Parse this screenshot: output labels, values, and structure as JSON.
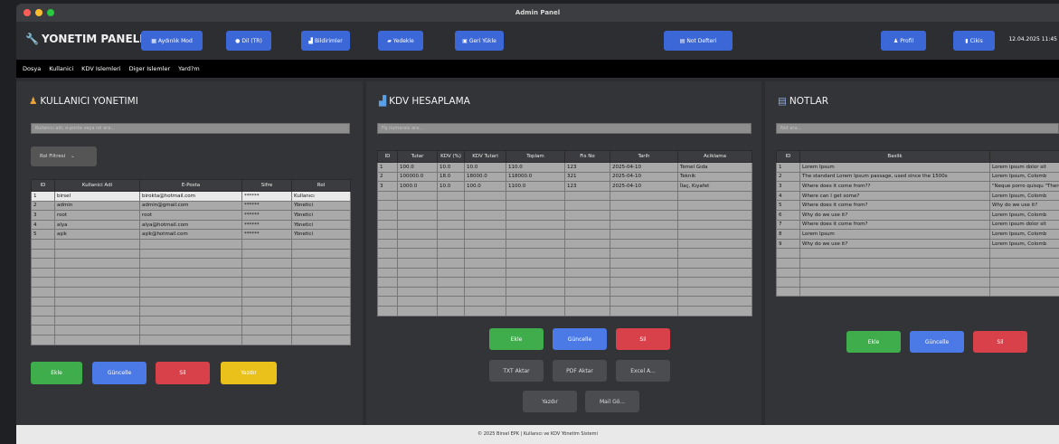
{
  "window": {
    "title": "Admin Panel"
  },
  "colors": {
    "primary": "#3c67d6",
    "green": "#3fad4c",
    "red": "#d8404a",
    "yellow": "#e9c11a"
  },
  "toolbar": {
    "brand": "YONETIM PANELI",
    "buttons": [
      "Aydınlık Mod",
      "Dil (TR)",
      "Bildirimler",
      "Yedekle",
      "Geri Yükle",
      "Not Defteri",
      "Profil",
      "Cikis"
    ],
    "datetime": "12.04.2025 11:45"
  },
  "menu": [
    "Dosya",
    "Kullanici",
    "KDV Islemleri",
    "Diger Islemler",
    "Yard?m"
  ],
  "users": {
    "title": "KULLANICI YONETIMI",
    "search_placeholder": "Kullanıcı adı, e-posta veya rol ara...",
    "filter": "Rol Filtresi",
    "columns": [
      "ID",
      "Kullanici Adi",
      "E-Posta",
      "Sifre",
      "Rol"
    ],
    "rows": [
      [
        "1",
        "birsel",
        "birokta@hotmail.com",
        "******",
        "Kullanıcı"
      ],
      [
        "2",
        "admin",
        "admin@gmail.com",
        "******",
        "Yönetici"
      ],
      [
        "3",
        "root",
        "root",
        "******",
        "Yönetici"
      ],
      [
        "4",
        "alya",
        "alya@hotmail.com",
        "******",
        "Yönetici"
      ],
      [
        "5",
        "aşik",
        "aşik@hotmail.com",
        "******",
        "Yönetici"
      ]
    ],
    "buttons": [
      "Ekle",
      "Güncelle",
      "Sil",
      "Yazdır"
    ]
  },
  "kdv": {
    "title": "KDV HESAPLAMA",
    "search_placeholder": "Fiş numarası ara...",
    "columns": [
      "ID",
      "Tutar",
      "KDV (%)",
      "KDV Tutari",
      "Toplam",
      "Fis No",
      "Tarih",
      "Aciklama"
    ],
    "rows": [
      [
        "1",
        "100.0",
        "10.0",
        "10.0",
        "110.0",
        "123",
        "2025-04-10",
        "Temel Gıda"
      ],
      [
        "2",
        "100000.0",
        "18.0",
        "18000.0",
        "118000.0",
        "321",
        "2025-04-10",
        "Teknik"
      ],
      [
        "3",
        "1000.0",
        "10.0",
        "100.0",
        "1100.0",
        "123",
        "2025-04-10",
        "İlaç, Kıyafet"
      ]
    ],
    "buttons": [
      "Ekle",
      "Güncelle",
      "Sil"
    ],
    "export_buttons": [
      "TXT Aktar",
      "PDF Aktar",
      "Excel A..."
    ],
    "other_buttons": [
      "Yazdır",
      "Mail Gö..."
    ]
  },
  "notes": {
    "title": "NOTLAR",
    "search_placeholder": "Not ara...",
    "columns": [
      "ID",
      "Baslik",
      ""
    ],
    "rows": [
      [
        "1",
        "Lorem Ipsum",
        "Lorem ipsum dolor sit"
      ],
      [
        "2",
        "The standard Lorem Ipsum passage, used since the 1500s",
        "Lorem Ipsum, Colomb"
      ],
      [
        "3",
        "Where does it come from??",
        "\"Neque porro quisqu\n\"There is no one who"
      ],
      [
        "4",
        "Where can I get some?",
        "Lorem Ipsum, Colomb"
      ],
      [
        "5",
        "Where does it come from?",
        "Why do we use it?"
      ],
      [
        "6",
        "Why do we use it?",
        "Lorem Ipsum, Colomb"
      ],
      [
        "7",
        "Where does it come from?",
        "Lorem ipsum dolor sit"
      ],
      [
        "8",
        "Lorem Ipsum",
        "Lorem Ipsum, Colomb"
      ],
      [
        "9",
        "Why do we use it?",
        "Lorem Ipsum, Colomb"
      ]
    ],
    "buttons": [
      "Ekle",
      "Güncelle",
      "Sil"
    ]
  },
  "footer": "© 2025 Birsel EPK | Kullanıcı ve KDV Yönetim Sistemi"
}
